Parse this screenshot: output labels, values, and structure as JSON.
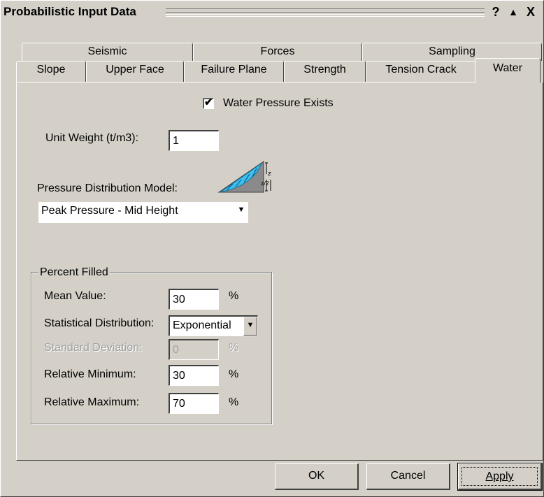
{
  "window": {
    "title": "Probabilistic Input Data",
    "help_label": "?",
    "collapse_label": "▲",
    "close_label": "X"
  },
  "tabs": {
    "back_row": [
      {
        "label": "Seismic"
      },
      {
        "label": "Forces"
      },
      {
        "label": "Sampling"
      }
    ],
    "front_row": [
      {
        "label": "Slope"
      },
      {
        "label": "Upper Face"
      },
      {
        "label": "Failure Plane"
      },
      {
        "label": "Strength"
      },
      {
        "label": "Tension Crack"
      },
      {
        "label": "Water",
        "active": true
      }
    ]
  },
  "water": {
    "water_pressure_exists": {
      "label": "Water Pressure Exists",
      "checked": true
    },
    "unit_weight": {
      "label": "Unit Weight (t/m3):",
      "value": "1"
    },
    "pressure_model": {
      "label": "Pressure Distribution Model:",
      "selected": "Peak Pressure - Mid Height",
      "icon": "pressure-distribution-diagram-icon"
    },
    "percent_filled": {
      "title": "Percent Filled",
      "mean": {
        "label": "Mean Value:",
        "value": "30",
        "unit": "%"
      },
      "distribution": {
        "label": "Statistical Distribution:",
        "selected": "Exponential"
      },
      "std_dev": {
        "label": "Standard Deviation:",
        "value": "0",
        "unit": "%",
        "disabled": true
      },
      "rel_min": {
        "label": "Relative Minimum:",
        "value": "30",
        "unit": "%"
      },
      "rel_max": {
        "label": "Relative Maximum:",
        "value": "70",
        "unit": "%"
      }
    }
  },
  "buttons": {
    "ok": "OK",
    "cancel": "Cancel",
    "apply": "Apply"
  }
}
